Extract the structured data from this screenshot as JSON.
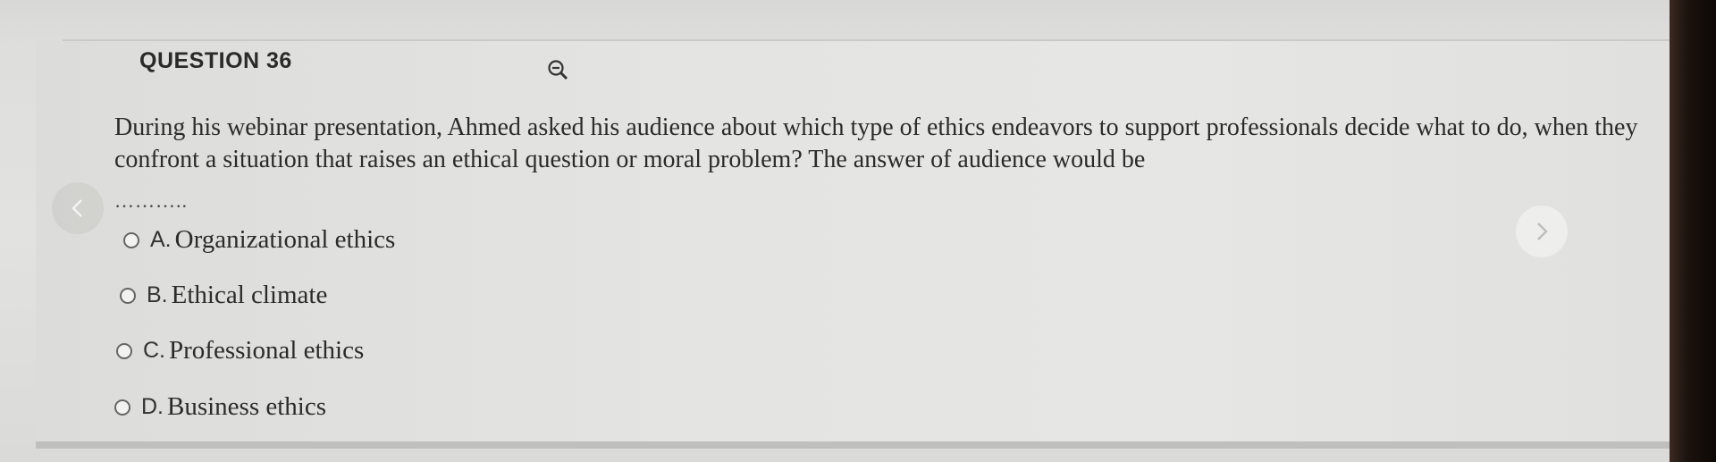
{
  "question": {
    "label": "QUESTION 36",
    "text": "During his webinar presentation, Ahmed asked his audience about which type of ethics endeavors to support professionals decide what to do, when they confront a situation that raises an ethical question or moral problem? The answer of audience would be",
    "blank": "……….."
  },
  "icons": {
    "zoom": "zoom-out-icon",
    "prev": "chevron-left-icon",
    "next": "chevron-right-icon"
  },
  "options": [
    {
      "letter": "A.",
      "text": "Organizational ethics"
    },
    {
      "letter": "B.",
      "text": "Ethical climate"
    },
    {
      "letter": "C.",
      "text": "Professional ethics"
    },
    {
      "letter": "D.",
      "text": "Business ethics"
    }
  ]
}
